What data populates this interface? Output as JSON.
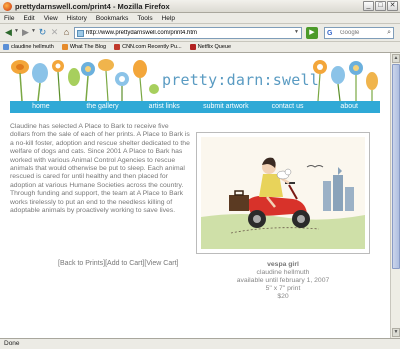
{
  "window": {
    "title": "prettydarnswell.com/print4 - Mozilla Firefox"
  },
  "menu": [
    "File",
    "Edit",
    "View",
    "History",
    "Bookmarks",
    "Tools",
    "Help"
  ],
  "toolbar": {
    "back_icon": "back-arrow-icon",
    "forward_icon": "forward-arrow-icon",
    "reload_icon": "reload-icon",
    "stop_icon": "stop-icon",
    "home_icon": "home-icon",
    "url": "http://www.prettydarnswell.com/print4.htm",
    "search_placeholder": "Google"
  },
  "bookmarks": [
    {
      "label": "claudine hellmuth",
      "color": "#5a8fd6"
    },
    {
      "label": "What The Blog",
      "color": "#e58a2b"
    },
    {
      "label": "CNN.com Recently Pu...",
      "color": "#c0392b"
    },
    {
      "label": "Netflix Queue",
      "color": "#b22222"
    }
  ],
  "site": {
    "title": "pretty:darn:swell",
    "accent": "#2fa9d6",
    "nav": [
      "home",
      "the gallery",
      "artist links",
      "submit artwork",
      "contact us",
      "about"
    ]
  },
  "description": "Claudine has selected A Place to Bark to receive five dollars from the sale of each of her prints.  A Place to Bark is a no-kill foster, adoption and rescue shelter dedicated to the welfare of dogs and cats. Since 2001 A Place to Bark has worked with various Animal Control Agencies to rescue animals that would otherwise be put to sleep. Each animal rescued is cared for until healthy and then placed for adoption at various Humane Societies across the country. Through funding and support, the team at A Place to Bark works tirelessly to put an end to the needless killing of adoptable animals by proactively working to save lives.",
  "links": {
    "back": "[Back to Prints]",
    "add": "[Add to Cart]",
    "view": "[View Cart]"
  },
  "print": {
    "title": "vespa girl",
    "artist": "claudine hellmuth",
    "availability": "available until february 1, 2007",
    "size": "5\" x 7\" print",
    "price": "$20"
  },
  "status": "Done"
}
